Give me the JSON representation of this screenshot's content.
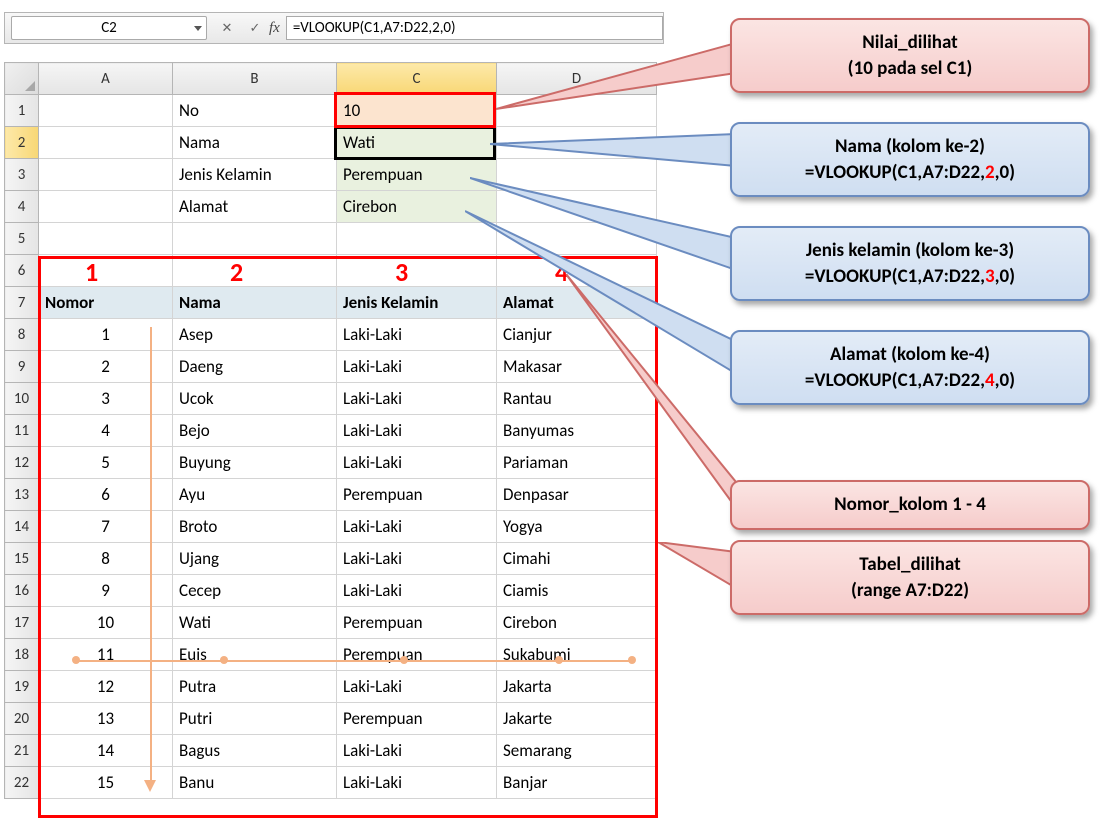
{
  "namebox": {
    "cell_ref": "C2"
  },
  "formula_bar": {
    "fx_label": "fx",
    "value": "=VLOOKUP(C1,A7:D22,2,0)"
  },
  "columns": {
    "A": "A",
    "B": "B",
    "C": "C",
    "D": "D"
  },
  "row_labels": [
    "1",
    "2",
    "3",
    "4",
    "5",
    "6",
    "7",
    "8",
    "9",
    "10",
    "11",
    "12",
    "13",
    "14",
    "15",
    "16",
    "17",
    "18",
    "19",
    "20",
    "21",
    "22"
  ],
  "lookup": {
    "labels": {
      "no": "No",
      "nama": "Nama",
      "jk": "Jenis Kelamin",
      "alamat": "Alamat"
    },
    "values": {
      "no": "10",
      "nama": "Wati",
      "jk": "Perempuan",
      "alamat": "Cirebon"
    }
  },
  "column_numbers": [
    "1",
    "2",
    "3",
    "4"
  ],
  "table": {
    "headers": {
      "nomor": "Nomor",
      "nama": "Nama",
      "jk": "Jenis Kelamin",
      "alamat": "Alamat"
    },
    "rows": [
      {
        "n": "1",
        "nama": "Asep",
        "jk": "Laki-Laki",
        "al": "Cianjur"
      },
      {
        "n": "2",
        "nama": "Daeng",
        "jk": "Laki-Laki",
        "al": "Makasar"
      },
      {
        "n": "3",
        "nama": "Ucok",
        "jk": "Laki-Laki",
        "al": "Rantau"
      },
      {
        "n": "4",
        "nama": "Bejo",
        "jk": "Laki-Laki",
        "al": "Banyumas"
      },
      {
        "n": "5",
        "nama": "Buyung",
        "jk": "Laki-Laki",
        "al": "Pariaman"
      },
      {
        "n": "6",
        "nama": "Ayu",
        "jk": "Perempuan",
        "al": "Denpasar"
      },
      {
        "n": "7",
        "nama": "Broto",
        "jk": "Laki-Laki",
        "al": "Yogya"
      },
      {
        "n": "8",
        "nama": "Ujang",
        "jk": "Laki-Laki",
        "al": "Cimahi"
      },
      {
        "n": "9",
        "nama": "Cecep",
        "jk": "Laki-Laki",
        "al": "Ciamis"
      },
      {
        "n": "10",
        "nama": "Wati",
        "jk": "Perempuan",
        "al": "Cirebon"
      },
      {
        "n": "11",
        "nama": "Euis",
        "jk": "Perempuan",
        "al": "Sukabumi"
      },
      {
        "n": "12",
        "nama": "Putra",
        "jk": "Laki-Laki",
        "al": "Jakarta"
      },
      {
        "n": "13",
        "nama": "Putri",
        "jk": "Perempuan",
        "al": "Jakarte"
      },
      {
        "n": "14",
        "nama": "Bagus",
        "jk": "Laki-Laki",
        "al": "Semarang"
      },
      {
        "n": "15",
        "nama": "Banu",
        "jk": "Laki-Laki",
        "al": "Banjar"
      }
    ]
  },
  "callouts": {
    "nilai": {
      "line1": "Nilai_dilihat",
      "line2": "(10 pada sel C1)"
    },
    "nama": {
      "line1": "Nama (kolom ke-2)",
      "prefix": "=VLOOKUP(C1,A7:D22,",
      "num": "2",
      "suffix": ",0)"
    },
    "jk": {
      "line1": "Jenis kelamin (kolom ke-3)",
      "prefix": "=VLOOKUP(C1,A7:D22,",
      "num": "3",
      "suffix": ",0)"
    },
    "alamat": {
      "line1": "Alamat (kolom ke-4)",
      "prefix": "=VLOOKUP(C1,A7:D22,",
      "num": "4",
      "suffix": ",0)"
    },
    "nomor": {
      "text": "Nomor_kolom  1 - 4"
    },
    "tabel": {
      "line1": "Tabel_dilihat",
      "line2": "(range A7:D22)"
    }
  }
}
